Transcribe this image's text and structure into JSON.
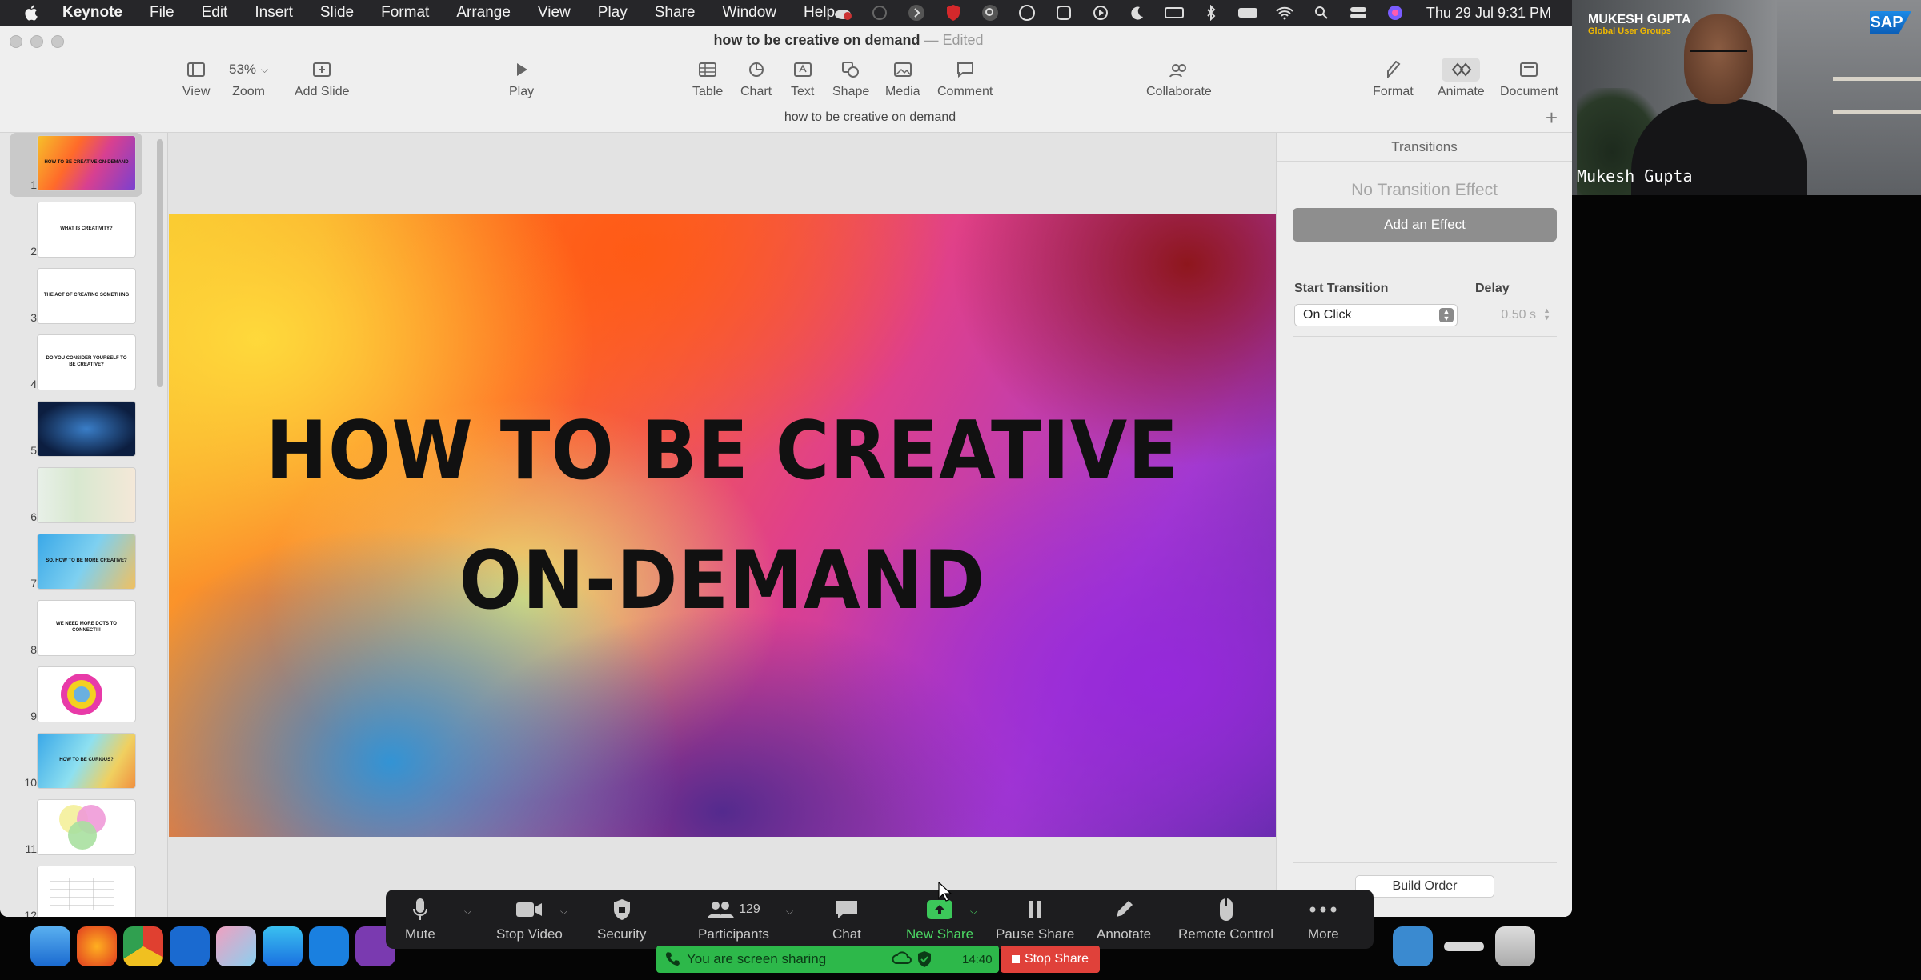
{
  "menubar": {
    "app_name": "Keynote",
    "menus": [
      "File",
      "Edit",
      "Insert",
      "Slide",
      "Format",
      "Arrange",
      "View",
      "Play",
      "Share",
      "Window",
      "Help"
    ],
    "datetime": "Thu 29 Jul  9:31 PM"
  },
  "window": {
    "doc_name": "how to be creative on demand",
    "separator": " — ",
    "edited": "Edited",
    "slide_subtitle": "how to be creative on demand"
  },
  "toolbar": {
    "view": "View",
    "zoom_value": "53%",
    "zoom": "Zoom",
    "add_slide": "Add Slide",
    "play": "Play",
    "table": "Table",
    "chart": "Chart",
    "text": "Text",
    "shape": "Shape",
    "media": "Media",
    "comment": "Comment",
    "collaborate": "Collaborate",
    "format": "Format",
    "animate": "Animate",
    "document": "Document",
    "active_tab": "Animate"
  },
  "navigator": {
    "selected": 1,
    "slides": [
      {
        "num": "1",
        "text": "HOW TO BE CREATIVE ON-DEMAND"
      },
      {
        "num": "2",
        "text": "WHAT IS CREATIVITY?"
      },
      {
        "num": "3",
        "text": "THE ACT OF CREATING SOMETHING"
      },
      {
        "num": "4",
        "text": "DO YOU CONSIDER YOURSELF TO BE CREATIVE?"
      },
      {
        "num": "5",
        "text": ""
      },
      {
        "num": "6",
        "text": ""
      },
      {
        "num": "7",
        "text": "SO, HOW TO BE MORE CREATIVE?"
      },
      {
        "num": "8",
        "text": "WE NEED MORE DOTS TO CONNECT!!!"
      },
      {
        "num": "9",
        "text": ""
      },
      {
        "num": "10",
        "text": "HOW TO BE CURIOUS?"
      },
      {
        "num": "11",
        "text": ""
      },
      {
        "num": "12",
        "text": ""
      }
    ]
  },
  "slide": {
    "line1": "HOW TO BE CREATIVE",
    "line2": "ON-DEMAND"
  },
  "inspector": {
    "tab": "Transitions",
    "no_effect": "No Transition Effect",
    "add_effect": "Add an Effect",
    "start_label": "Start Transition",
    "start_value": "On Click",
    "delay_label": "Delay",
    "delay_value": "0.50 s",
    "build_order": "Build Order"
  },
  "video": {
    "banner_name": "MUKESH GUPTA",
    "banner_org": "Global User Groups",
    "logo": "SAP",
    "participant": "Mukesh Gupta"
  },
  "zoom_toolbar": {
    "mute": "Mute",
    "stop_video": "Stop Video",
    "security": "Security",
    "participants": "Participants",
    "participant_count": "129",
    "chat": "Chat",
    "new_share": "New Share",
    "pause_share": "Pause Share",
    "annotate": "Annotate",
    "remote_control": "Remote Control",
    "more": "More"
  },
  "share_banner": {
    "text": "You are screen sharing",
    "time": "14:40",
    "stop": "Stop Share"
  },
  "colors": {
    "share_green": "#2db84a",
    "stop_red": "#e0413a",
    "new_share_green": "#4cd964"
  },
  "icons": [
    "apple-icon",
    "view-icon",
    "add-slide-icon",
    "play-icon",
    "table-icon",
    "chart-icon",
    "text-icon",
    "shape-icon",
    "media-icon",
    "comment-icon",
    "collaborate-icon",
    "format-icon",
    "animate-icon",
    "document-icon",
    "microphone-icon",
    "camera-icon",
    "shield-icon",
    "people-icon",
    "chat-icon",
    "upload-arrow-icon",
    "pause-icon",
    "pencil-icon",
    "mouse-icon",
    "more-dots-icon"
  ]
}
